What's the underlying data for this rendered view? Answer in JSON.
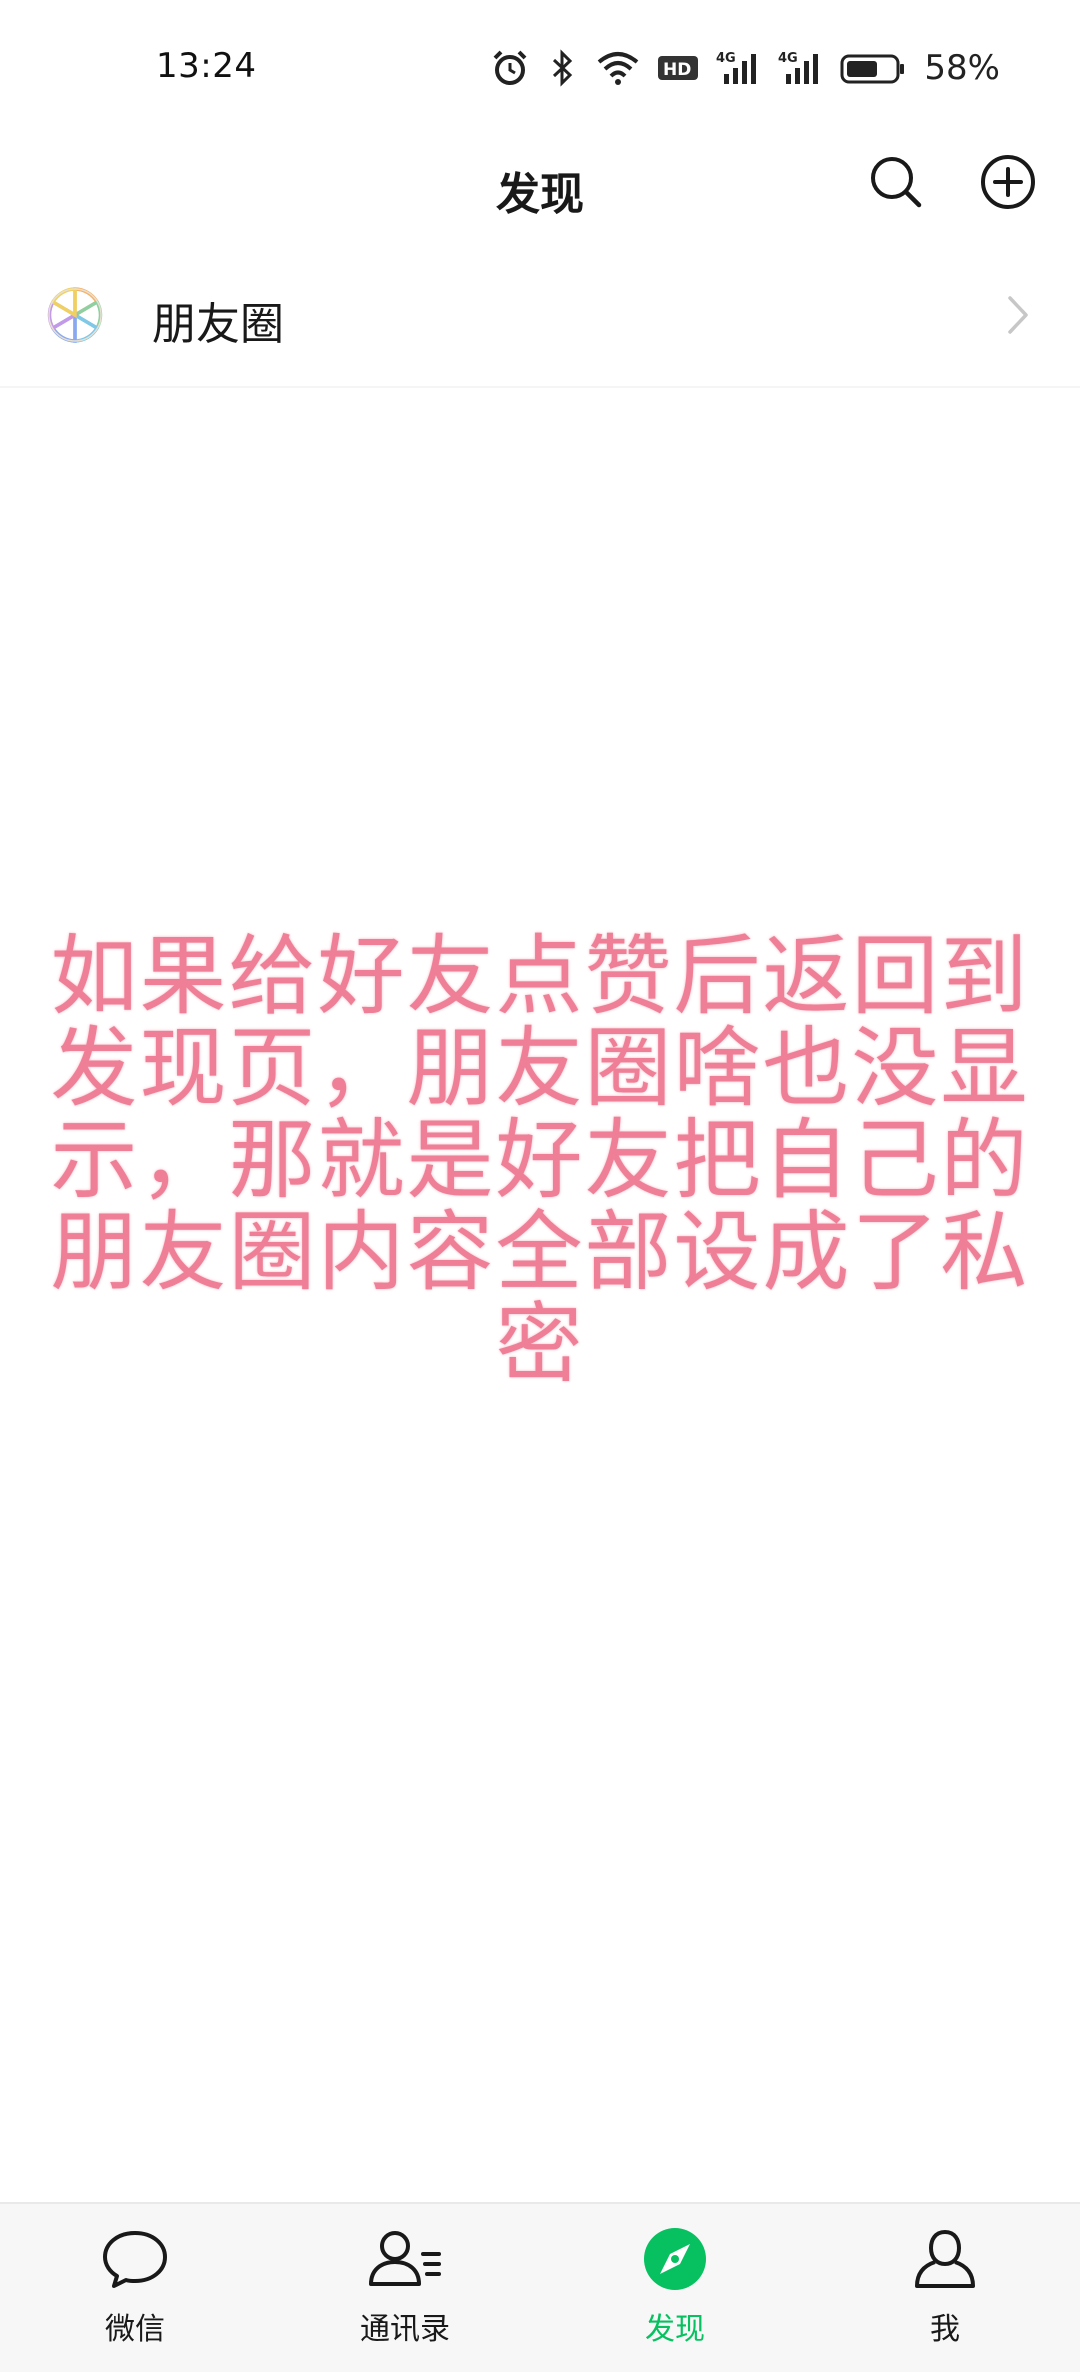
{
  "status_bar": {
    "time": "13:24",
    "battery_percent": "58%",
    "icons": [
      "alarm-icon",
      "bluetooth-icon",
      "wifi-icon",
      "hd-icon",
      "signal-4g-icon",
      "signal-4g-icon",
      "battery-icon"
    ],
    "hd_label": "HD",
    "network_label": "4G"
  },
  "header": {
    "title": "发现",
    "actions": [
      "search-icon",
      "add-circle-icon"
    ]
  },
  "discover_items": [
    {
      "label": "朋友圈",
      "icon": "moments-icon"
    }
  ],
  "overlay_caption": {
    "text": "如果给好友点赞后返回到发现页，朋友圈啥也没显示，那就是好友把自己的朋友圈内容全部设成了私密",
    "color": "#ee7f96"
  },
  "tab_bar": {
    "tabs": [
      {
        "label": "微信",
        "icon": "chat-bubble-icon",
        "active": false
      },
      {
        "label": "通讯录",
        "icon": "contacts-icon",
        "active": false
      },
      {
        "label": "发现",
        "icon": "compass-icon",
        "active": true
      },
      {
        "label": "我",
        "icon": "person-icon",
        "active": false
      }
    ]
  },
  "colors": {
    "accent": "#07c160",
    "caption": "#ee7f96",
    "tabbar_bg": "#f7f7f7"
  }
}
